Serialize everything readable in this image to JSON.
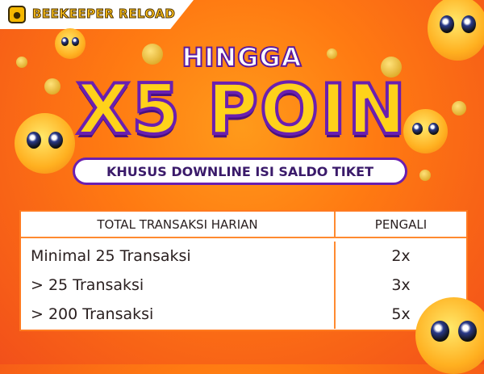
{
  "brand": {
    "name": "BEEKEEPER RELOAD",
    "logo_icon": "bee-logo-icon"
  },
  "headline": {
    "pre": "HINGGA",
    "main": "X5 POIN",
    "subtitle": "KHUSUS DOWNLINE ISI SALDO TIKET"
  },
  "table": {
    "headers": [
      "TOTAL TRANSAKSI HARIAN",
      "PENGALI"
    ],
    "rows": [
      {
        "condition": "Minimal 25 Transaksi",
        "multiplier": "2x"
      },
      {
        "condition": "> 25 Transaksi",
        "multiplier": "3x"
      },
      {
        "condition": "> 200 Transaksi",
        "multiplier": "5x"
      }
    ]
  },
  "colors": {
    "background": "#ff7a12",
    "headline": "#ffd21a",
    "outline": "#6a1fb0"
  }
}
